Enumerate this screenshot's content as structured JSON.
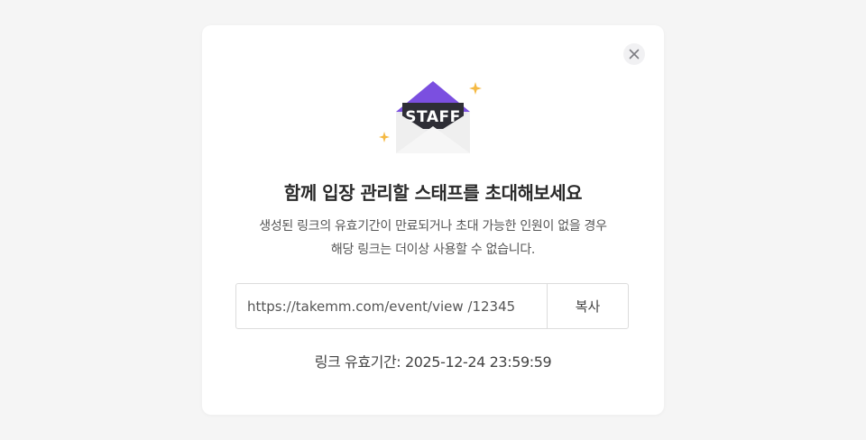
{
  "modal": {
    "close_icon": "close-icon",
    "illustration": {
      "icon": "envelope-icon",
      "envelope_label": "STAFF",
      "accent_color": "#7b4fe0",
      "sparkle_color": "#f5b942"
    },
    "title": "함께 입장 관리할 스태프를 초대해보세요",
    "description_line1": "생성된 링크의 유효기간이 만료되거나 초대 가능한 인원이 없을 경우",
    "description_line2": "해당 링크는 더이상 사용할 수 없습니다.",
    "link_value": "https://takemm.com/event/view /12345",
    "copy_label": "복사",
    "expiry_text": "링크 유효기간: 2025-12-24 23:59:59"
  }
}
